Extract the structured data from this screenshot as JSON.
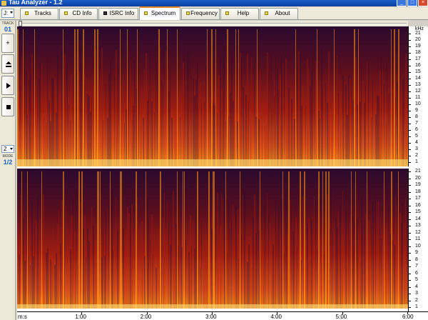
{
  "window": {
    "title": "Tau Analyzer - 1.2",
    "buttons": [
      "_",
      "□",
      "×"
    ]
  },
  "drive": {
    "value": "J:"
  },
  "tabs": [
    {
      "label": "Tracks",
      "active": false,
      "icon": "tracks-icon"
    },
    {
      "label": "CD Info",
      "active": false,
      "icon": "cdinfo-icon"
    },
    {
      "label": "ISRC Info",
      "active": false,
      "icon": "isrc-icon"
    },
    {
      "label": "Spectrum",
      "active": true,
      "icon": "spectrum-icon"
    },
    {
      "label": "Frequency",
      "active": false,
      "icon": "frequency-icon"
    },
    {
      "label": "Help",
      "active": false,
      "icon": "help-icon"
    },
    {
      "label": "About",
      "active": false,
      "icon": "about-icon"
    }
  ],
  "left_panel": {
    "track_label": "TRACK",
    "track_value": "01",
    "buttons": [
      {
        "glyph": "+",
        "icon": "add-icon"
      },
      {
        "glyph": "eject",
        "icon": "eject-icon"
      },
      {
        "glyph": "play",
        "icon": "play-icon"
      },
      {
        "glyph": "stop",
        "icon": "stop-icon"
      }
    ],
    "mode_select": "2",
    "mode_label": "MODE",
    "mode_value": "1/2"
  },
  "slider": {
    "position": 0.0
  },
  "spectrum": {
    "khz_unit": "kHz",
    "khz_ticks": [
      "21",
      "20",
      "19",
      "18",
      "17",
      "16",
      "15",
      "14",
      "13",
      "12",
      "11",
      "10",
      "9",
      "8",
      "7",
      "6",
      "5",
      "4",
      "3",
      "2",
      "1"
    ],
    "channels": 2,
    "colors": {
      "dark": "#2a0a2e",
      "mid": "#a01e10",
      "bright": "#ff9a1a",
      "peak": "#ffe07a"
    }
  },
  "time_axis": {
    "labels": [
      "m:s",
      "1:00",
      "2:00",
      "3:00",
      "4:00",
      "5:00",
      "6:00"
    ],
    "max_minutes": 6
  }
}
